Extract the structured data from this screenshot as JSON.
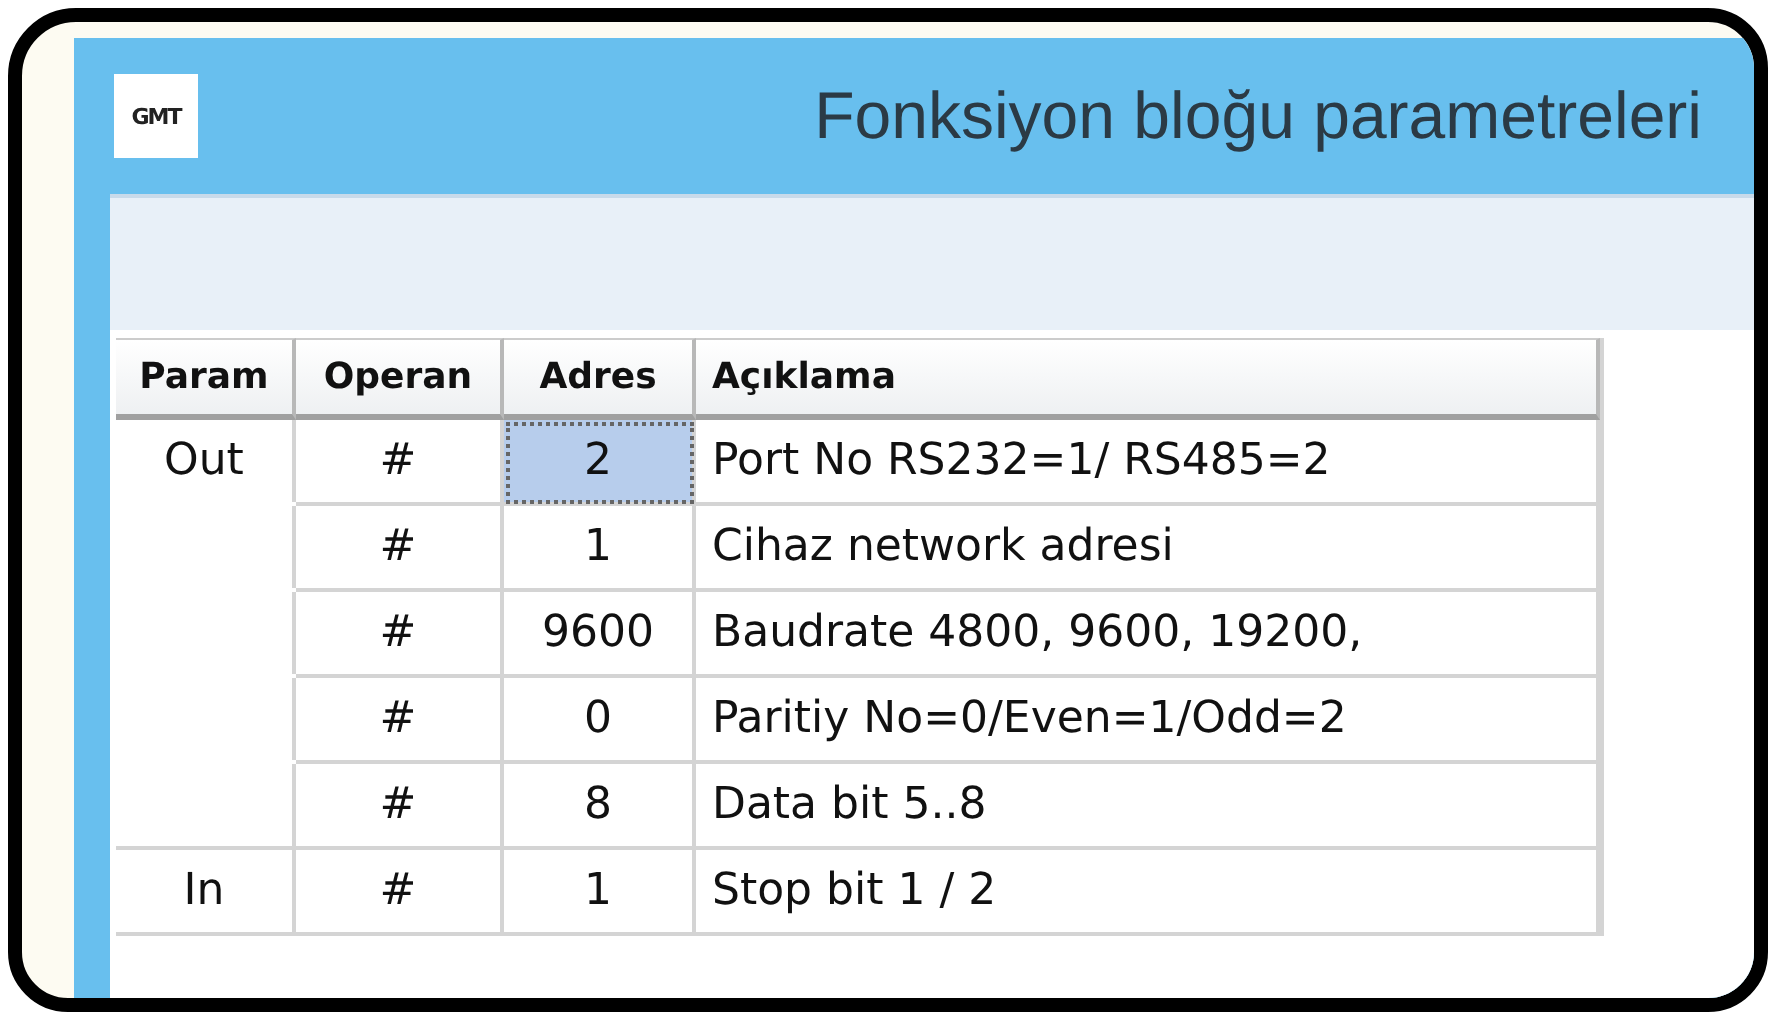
{
  "window": {
    "logo": "GMT",
    "title": "Fonksiyon bloğu parametreleri"
  },
  "table": {
    "columns": [
      "Param",
      "Operan",
      "Adres",
      "Açıklama"
    ],
    "rows": [
      {
        "param": "Out",
        "operan": "#",
        "adres": "2",
        "aciklama": "Port No RS232=1/ RS485=2",
        "selected": true
      },
      {
        "operan": "#",
        "adres": "1",
        "aciklama": "Cihaz network adresi",
        "selected": false
      },
      {
        "operan": "#",
        "adres": "9600",
        "aciklama": "Baudrate 4800, 9600, 19200,",
        "selected": false
      },
      {
        "operan": "#",
        "adres": "0",
        "aciklama": "Paritiy No=0/Even=1/Odd=2",
        "selected": false
      },
      {
        "operan": "#",
        "adres": "8",
        "aciklama": "Data bit 5..8",
        "selected": false
      },
      {
        "param": "In",
        "operan": "#",
        "adres": "1",
        "aciklama": "Stop bit 1 / 2",
        "selected": false
      }
    ]
  }
}
